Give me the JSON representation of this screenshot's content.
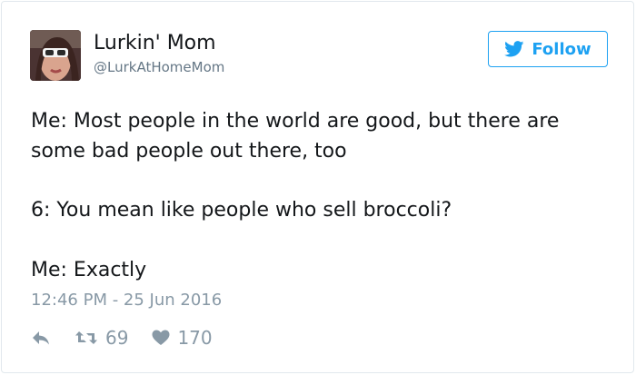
{
  "tweet": {
    "author_name": "Lurkin' Mom",
    "author_handle": "@LurkAtHomeMom",
    "follow_label": "Follow",
    "lines": [
      "Me: Most people in the world are good, but there are some bad people out there, too",
      "6: You mean like people who sell broccoli?",
      "Me: Exactly"
    ],
    "timestamp": "12:46 PM - 25 Jun 2016",
    "retweet_count": "69",
    "like_count": "170"
  },
  "icons": {
    "follow": "twitter-bird-icon",
    "reply": "reply-icon",
    "retweet": "retweet-icon",
    "like": "heart-icon"
  },
  "colors": {
    "accent": "#1da1f2",
    "muted": "#8899a6",
    "text": "#14171a",
    "border": "#e1e8ed"
  }
}
